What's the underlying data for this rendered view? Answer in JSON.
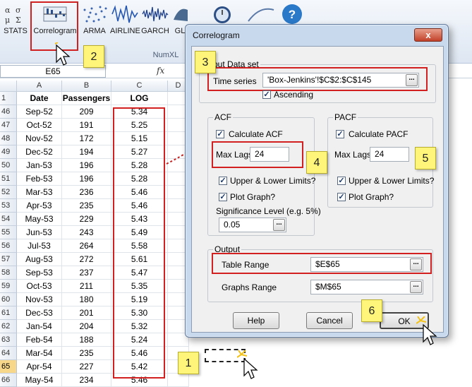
{
  "ribbon": {
    "buttons": [
      {
        "label": "STATS",
        "icon": "stats-icon"
      },
      {
        "label": "Correlogram",
        "icon": "correlogram-icon"
      },
      {
        "label": "ARMA",
        "icon": "arma-icon"
      },
      {
        "label": "AIRLINE",
        "icon": "airline-icon"
      },
      {
        "label": "GARCH",
        "icon": "garch-icon"
      },
      {
        "label": "GL",
        "icon": "gl-icon"
      }
    ],
    "group_label": "NumXL"
  },
  "formula_bar": {
    "name_box": "E65",
    "fx": "fx"
  },
  "sheet": {
    "columns": [
      "A",
      "B",
      "C",
      "D"
    ],
    "header_row": {
      "num": "1",
      "cells": [
        "Date",
        "Passengers",
        "LOG"
      ]
    },
    "rows": [
      {
        "num": "46",
        "date": "Sep-52",
        "passengers": "209",
        "log": "5.34"
      },
      {
        "num": "47",
        "date": "Oct-52",
        "passengers": "191",
        "log": "5.25"
      },
      {
        "num": "48",
        "date": "Nov-52",
        "passengers": "172",
        "log": "5.15"
      },
      {
        "num": "49",
        "date": "Dec-52",
        "passengers": "194",
        "log": "5.27"
      },
      {
        "num": "50",
        "date": "Jan-53",
        "passengers": "196",
        "log": "5.28"
      },
      {
        "num": "51",
        "date": "Feb-53",
        "passengers": "196",
        "log": "5.28"
      },
      {
        "num": "52",
        "date": "Mar-53",
        "passengers": "236",
        "log": "5.46"
      },
      {
        "num": "53",
        "date": "Apr-53",
        "passengers": "235",
        "log": "5.46"
      },
      {
        "num": "54",
        "date": "May-53",
        "passengers": "229",
        "log": "5.43"
      },
      {
        "num": "55",
        "date": "Jun-53",
        "passengers": "243",
        "log": "5.49"
      },
      {
        "num": "56",
        "date": "Jul-53",
        "passengers": "264",
        "log": "5.58"
      },
      {
        "num": "57",
        "date": "Aug-53",
        "passengers": "272",
        "log": "5.61"
      },
      {
        "num": "58",
        "date": "Sep-53",
        "passengers": "237",
        "log": "5.47"
      },
      {
        "num": "59",
        "date": "Oct-53",
        "passengers": "211",
        "log": "5.35"
      },
      {
        "num": "60",
        "date": "Nov-53",
        "passengers": "180",
        "log": "5.19"
      },
      {
        "num": "61",
        "date": "Dec-53",
        "passengers": "201",
        "log": "5.30"
      },
      {
        "num": "62",
        "date": "Jan-54",
        "passengers": "204",
        "log": "5.32"
      },
      {
        "num": "63",
        "date": "Feb-54",
        "passengers": "188",
        "log": "5.24"
      },
      {
        "num": "64",
        "date": "Mar-54",
        "passengers": "235",
        "log": "5.46"
      },
      {
        "num": "65",
        "date": "Apr-54",
        "passengers": "227",
        "log": "5.42"
      },
      {
        "num": "66",
        "date": "May-54",
        "passengers": "234",
        "log": "5.46"
      }
    ]
  },
  "dialog": {
    "title": "Correlogram",
    "close": "x",
    "input_group": "Input Data set",
    "time_series_label": "Time series",
    "time_series_value": "'Box-Jenkins'!$C$2:$C$145",
    "ascending_label": "Ascending",
    "acf": {
      "group": "ACF",
      "calc_label": "Calculate ACF",
      "max_lags_label": "Max Lags",
      "max_lags_value": "24",
      "limits_label": "Upper & Lower Limits?",
      "plot_label": "Plot Graph?",
      "sig_label": "Significance Level (e.g. 5%)",
      "sig_value": "0.05"
    },
    "pacf": {
      "group": "PACF",
      "calc_label": "Calculate PACF",
      "max_lags_label": "Max Lags",
      "max_lags_value": "24",
      "limits_label": "Upper & Lower Limits?",
      "plot_label": "Plot Graph?"
    },
    "output": {
      "group": "Output",
      "table_label": "Table Range",
      "table_value": "$E$65",
      "graphs_label": "Graphs Range",
      "graphs_value": "$M$65"
    },
    "help_button": "Help",
    "cancel_button": "Cancel",
    "ok_button": "OK",
    "ellipsis": "..."
  },
  "callouts": [
    "1",
    "2",
    "3",
    "4",
    "5",
    "6"
  ],
  "colors": {
    "highlight": "#d21f1f",
    "callout": "#fff57a",
    "dialog_frame": "#c9d9ed"
  }
}
